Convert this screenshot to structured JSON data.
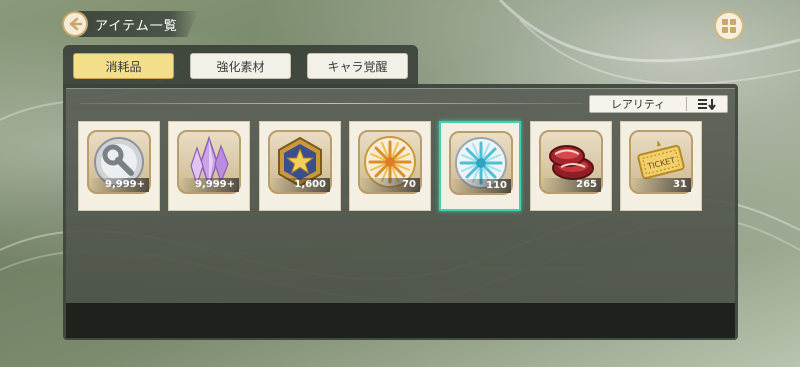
{
  "header": {
    "title": "アイテム一覧",
    "back_icon": "back-arrow-icon",
    "menu_icon": "grid-menu-icon"
  },
  "tabs": [
    {
      "label": "消耗品",
      "active": true
    },
    {
      "label": "強化素材",
      "active": false
    },
    {
      "label": "キャラ覚醒",
      "active": false
    }
  ],
  "sort": {
    "label": "レアリティ",
    "icon": "sort-descending-icon"
  },
  "items": [
    {
      "icon": "wrench-icon",
      "quantity": "9,999+",
      "selected": false
    },
    {
      "icon": "crystal-icon",
      "quantity": "9,999+",
      "selected": false
    },
    {
      "icon": "star-medal-icon",
      "quantity": "1,600",
      "selected": false
    },
    {
      "icon": "gold-emblem-icon",
      "quantity": "70",
      "selected": false
    },
    {
      "icon": "silver-emblem-icon",
      "quantity": "110",
      "selected": true
    },
    {
      "icon": "meat-icon",
      "quantity": "265",
      "selected": false
    },
    {
      "icon": "ticket-icon",
      "quantity": "31",
      "selected": false
    }
  ],
  "ticket_text": "TICKET",
  "colors": {
    "accent_gold": "#c9a86a",
    "selected_border": "#3fd2b0",
    "active_tab": "#f3df8a"
  }
}
